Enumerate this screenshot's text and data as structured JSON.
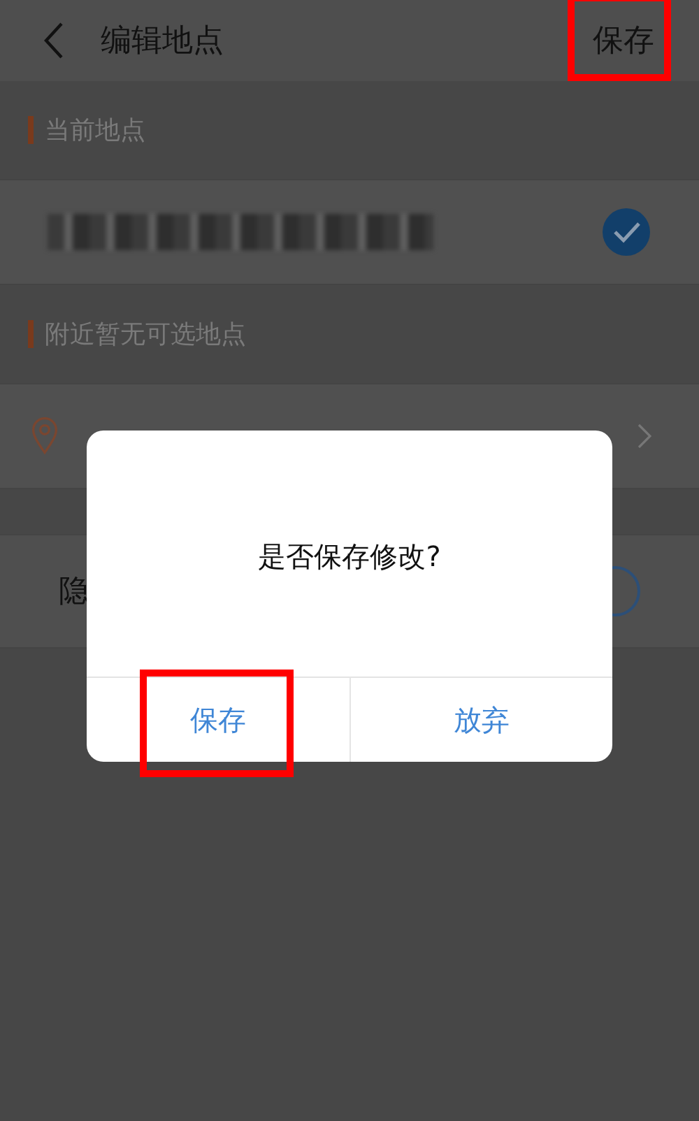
{
  "header": {
    "title": "编辑地点",
    "save": {
      "label": "保存",
      "highlighted": true
    }
  },
  "sections": [
    {
      "heading": "当前地点",
      "rows": [
        {
          "kind": "address",
          "checked": true
        }
      ]
    },
    {
      "heading": "附近暂无可选地点",
      "rows": [
        {
          "kind": "retry"
        }
      ]
    }
  ],
  "privacy_row": {
    "label": "隐",
    "selected": false
  },
  "dialog": {
    "message": "是否保存修改?",
    "buttons": [
      {
        "label": "保存",
        "highlighted": true
      },
      {
        "label": "放弃",
        "highlighted": false
      }
    ]
  }
}
